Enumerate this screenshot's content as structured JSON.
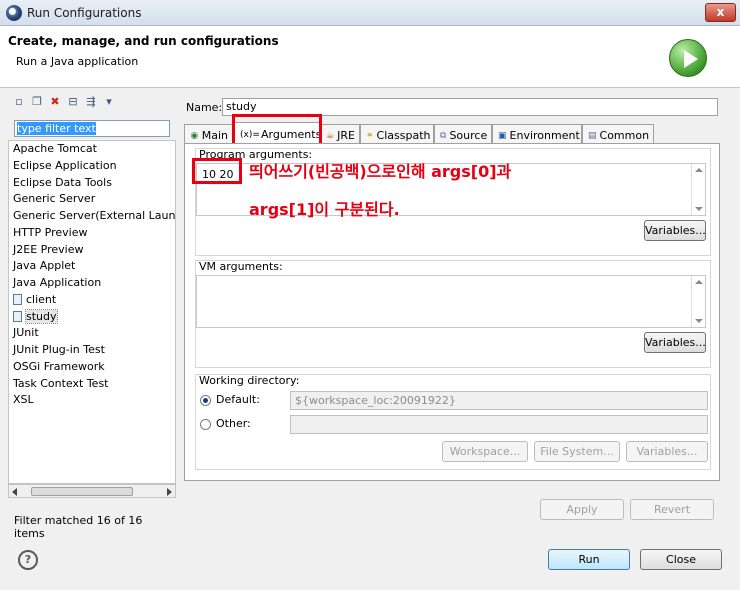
{
  "window": {
    "title": "Run Configurations",
    "close": "x"
  },
  "header": {
    "title": "Create, manage, and run configurations",
    "subtitle": "Run a Java application"
  },
  "left": {
    "filter_text": "type filter text",
    "items": [
      {
        "label": "Apache Tomcat",
        "child": false
      },
      {
        "label": "Eclipse Application",
        "child": false
      },
      {
        "label": "Eclipse Data Tools",
        "child": false
      },
      {
        "label": "Generic Server",
        "child": false
      },
      {
        "label": "Generic Server(External Launch)",
        "child": false
      },
      {
        "label": "HTTP Preview",
        "child": false
      },
      {
        "label": "J2EE Preview",
        "child": false
      },
      {
        "label": "Java Applet",
        "child": false
      },
      {
        "label": "Java Application",
        "child": false
      },
      {
        "label": "client",
        "child": true
      },
      {
        "label": "study",
        "child": true,
        "selected": true
      },
      {
        "label": "JUnit",
        "child": false
      },
      {
        "label": "JUnit Plug-in Test",
        "child": false
      },
      {
        "label": "OSGi Framework",
        "child": false
      },
      {
        "label": "Task Context Test",
        "child": false
      },
      {
        "label": "XSL",
        "child": false
      }
    ],
    "filter_matched": "Filter matched 16 of 16 items"
  },
  "right": {
    "name_label": "Name:",
    "name_value": "study",
    "tabs": [
      "Main",
      "Arguments",
      "JRE",
      "Classpath",
      "Source",
      "Environment",
      "Common"
    ],
    "program_args_label": "Program arguments:",
    "program_args_value": "10 20",
    "variables": "Variables...",
    "vm_args_label": "VM arguments:",
    "working_dir_label": "Working directory:",
    "default_label": "Default:",
    "default_value": "${workspace_loc:20091922}",
    "other_label": "Other:",
    "workspace_btn": "Workspace...",
    "filesystem_btn": "File System...",
    "apply": "Apply",
    "revert": "Revert"
  },
  "annotation": {
    "line1": "띄어쓰기(빈공백)으로인해 args[0]과",
    "line2": "args[1]이 구분된다.",
    "color": "#e60012"
  },
  "footer": {
    "run": "Run",
    "close": "Close",
    "help": "?"
  }
}
